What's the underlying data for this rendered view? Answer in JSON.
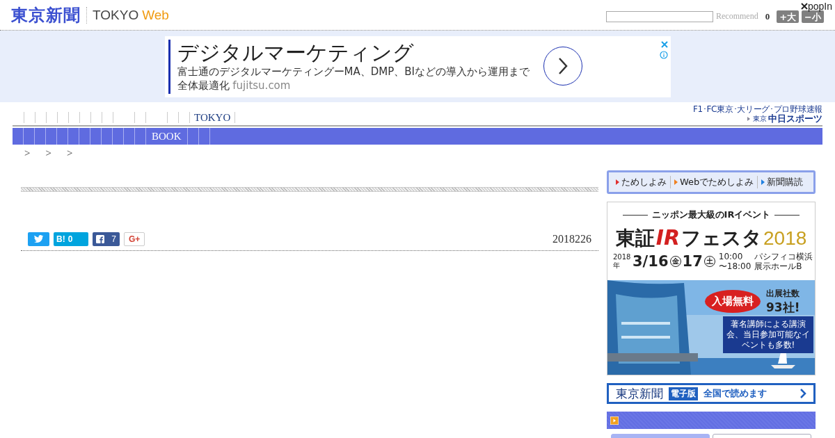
{
  "header": {
    "logo": "東京新聞",
    "site": "TOKYO",
    "site_accent": "Web",
    "recommend": "Recommend",
    "count": "0",
    "font_buttons": [
      "+大",
      "−小"
    ],
    "popin": "popIn"
  },
  "ad": {
    "title": "デジタルマーケティング",
    "text": "富士通のデジタルマーケティングーMA、DMP、BIなどの導入から運用まで全体最適化",
    "domain": "fujitsu.com"
  },
  "nav": {
    "top_items": [
      {
        "label": "TOKYO"
      }
    ],
    "bar_items": [
      {
        "label": "BOOK"
      }
    ]
  },
  "sports": {
    "tagline": "F1･FC東京･大リーグ･プロ野球速報",
    "brand_prefix": "東京",
    "brand": "中日スポーツ"
  },
  "breadcrumb": [
    ">",
    ">",
    ">"
  ],
  "share": [
    {
      "kind": "twitter"
    },
    {
      "kind": "hatena",
      "label": "B!",
      "count": "0"
    },
    {
      "kind": "facebook",
      "count": "7"
    },
    {
      "kind": "google",
      "label": "G+"
    }
  ],
  "date": "2018226",
  "sidebar": {
    "links": [
      {
        "label": "ためしよみ",
        "color": "#e03030"
      },
      {
        "label": "Webでためしよみ",
        "color": "#f08020"
      },
      {
        "label": "新聞購読",
        "color": "#2080e0"
      }
    ],
    "ir_banner": {
      "tagline": "ニッポン最大級のIRイベント",
      "title": "東証",
      "title_mark": "IR",
      "title_rest": "フェスタ",
      "year": "2018",
      "date_year": "2018年",
      "date1": "3/16",
      "day1": "金",
      "date2": "17",
      "day2": "土",
      "time": [
        "10:00",
        "〜18:00"
      ],
      "venue": [
        "パシフィコ横浜",
        "展示ホールB"
      ],
      "free": "入場無料",
      "exhibitors": "出展社数",
      "exhibitor_count": "93社!",
      "note": "著名講師による講演会、当日参加可能なイベントも多数!"
    },
    "epaper_banner": {
      "logo": "東京新聞",
      "badge": "電子版",
      "text": "全国で読めます"
    }
  }
}
